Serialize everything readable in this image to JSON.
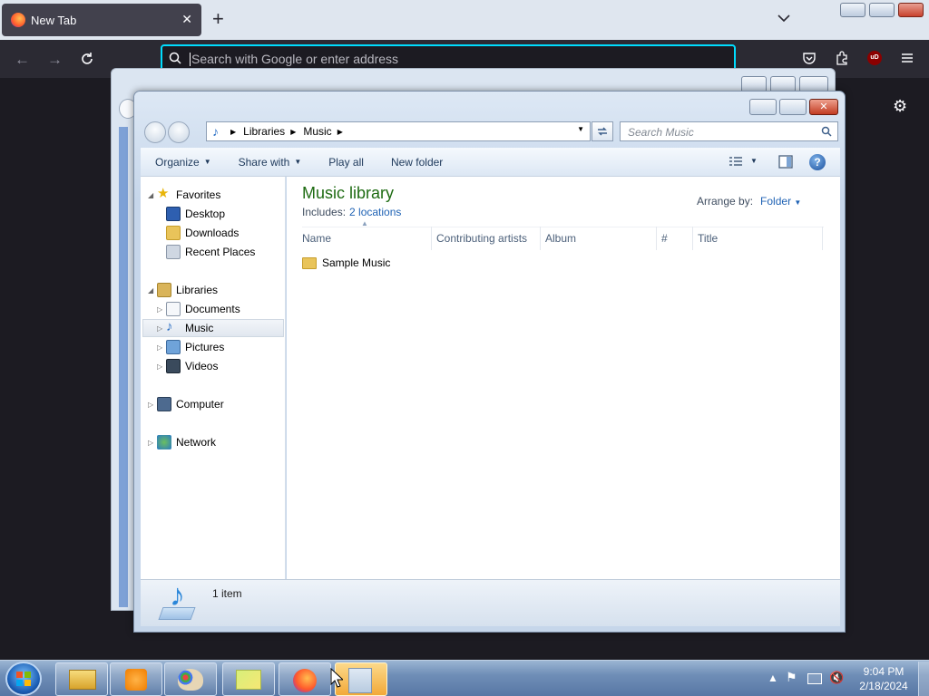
{
  "browser": {
    "tab_title": "New Tab",
    "tab_close": "✕",
    "new_tab": "+",
    "url_placeholder": "Search with Google or enter address",
    "ublock_label": "uD"
  },
  "explorer": {
    "address": {
      "segments": [
        "Libraries",
        "Music"
      ]
    },
    "search_placeholder": "Search Music",
    "commands": [
      "Organize",
      "Share with",
      "Play all",
      "New folder"
    ],
    "nav": {
      "favorites": "Favorites",
      "desktop": "Desktop",
      "downloads": "Downloads",
      "recent": "Recent Places",
      "libraries": "Libraries",
      "documents": "Documents",
      "music": "Music",
      "pictures": "Pictures",
      "videos": "Videos",
      "computer": "Computer",
      "network": "Network"
    },
    "library": {
      "title": "Music library",
      "includes_label": "Includes:",
      "includes_link": "2 locations",
      "arrange_label": "Arrange by:",
      "arrange_value": "Folder"
    },
    "columns": [
      "Name",
      "Contributing artists",
      "Album",
      "#",
      "Title"
    ],
    "items": [
      {
        "name": "Sample Music"
      }
    ],
    "status": "1 item"
  },
  "taskbar": {
    "time": "9:04 PM",
    "date": "2/18/2024"
  },
  "colors": {
    "accent_focus": "#00ddff",
    "library_title": "#1e6b12",
    "link": "#1f62b4"
  }
}
